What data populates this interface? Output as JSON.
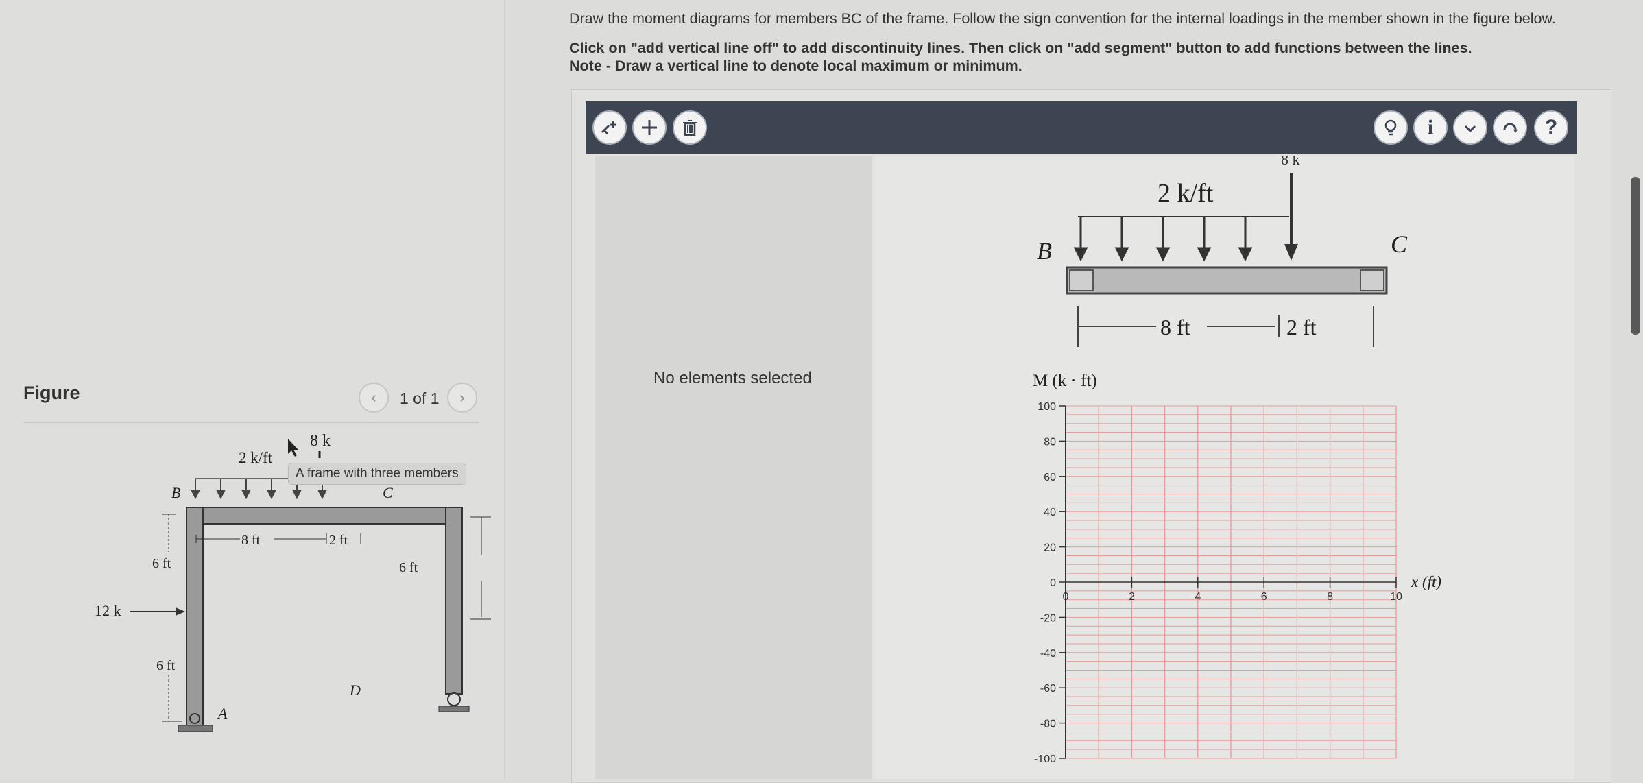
{
  "figure_panel": {
    "title": "Figure",
    "pager": {
      "prev_icon": "chevron-left-icon",
      "next_icon": "chevron-right-icon",
      "text": "1 of 1"
    },
    "tooltip": "A frame with three members",
    "diagram": {
      "load_point": "8 k",
      "load_dist": "2 k/ft",
      "label_b": "B",
      "label_c": "C",
      "label_d": "D",
      "label_a": "A",
      "dim_8": "8 ft",
      "dim_2": "2 ft",
      "dim_6_top": "6 ft",
      "dim_6_bottom": "6 ft",
      "dim_6_right": "6 ft",
      "load_horizontal": "12 k"
    }
  },
  "question": {
    "line1": "Draw the moment diagrams for members BC of the frame. Follow the sign convention for the internal loadings in the member shown in the figure below.",
    "line2": "Click on \"add vertical line off\" to add discontinuity lines. Then click on \"add segment\" button to add functions between the lines.",
    "line3": "Note - Draw a vertical line to denote local maximum or minimum."
  },
  "toolbar": {
    "left_buttons": [
      "add-vertical-line-icon",
      "add-segment-icon",
      "trash-icon"
    ],
    "right_buttons": [
      "hint-bulb-icon",
      "info-icon",
      "check-icon",
      "reset-icon",
      "help-icon"
    ],
    "help_glyph": "?",
    "info_glyph": "i"
  },
  "side_panel": {
    "status": "No elements selected"
  },
  "beam_diagram": {
    "top_load_label": "8 k",
    "dist_load": "2 k/ft",
    "label_b": "B",
    "label_c": "C",
    "dim_8": "8 ft",
    "dim_2": "2 ft"
  },
  "chart_data": {
    "type": "line",
    "ylabel": "M (k · ft)",
    "xlabel": "x (ft)",
    "xlim": [
      0,
      10
    ],
    "ylim": [
      -100,
      100
    ],
    "x_ticks": [
      0,
      2,
      4,
      6,
      8,
      10
    ],
    "y_ticks": [
      100,
      80,
      60,
      40,
      20,
      0,
      -20,
      -40,
      -60,
      -80,
      -100
    ],
    "grid": true,
    "series": []
  },
  "colors": {
    "toolbar": "#3d4552",
    "grid_line": "#e89a9a",
    "grid_axis": "#333333"
  }
}
